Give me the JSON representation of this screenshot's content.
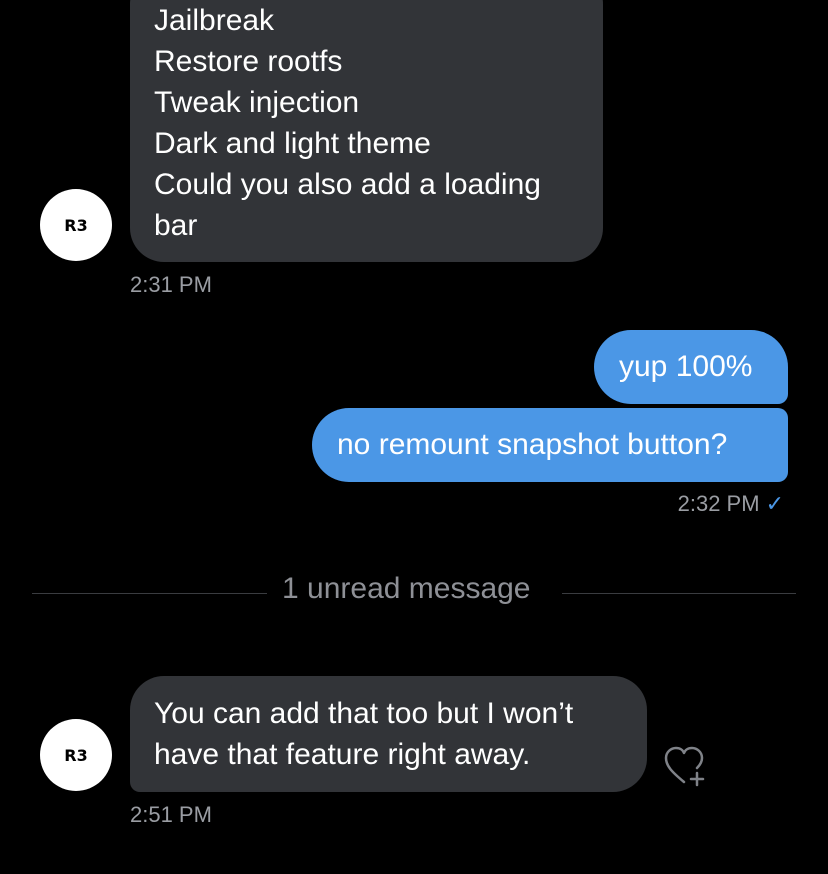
{
  "conversation": {
    "messages": [
      {
        "direction": "incoming",
        "avatar_initials": "R3",
        "lines": [
          "Jailbreak",
          "Restore rootfs",
          "Tweak injection",
          "Dark and light theme",
          "Could you also add a loading",
          "bar"
        ],
        "time": "2:31 PM"
      },
      {
        "direction": "outgoing",
        "text": "yup 100%"
      },
      {
        "direction": "outgoing",
        "text": "no remount snapshot button?",
        "time": "2:32 PM",
        "read_check": "✓"
      },
      {
        "direction": "incoming",
        "avatar_initials": "R3",
        "lines": [
          "You can add that too but I won’t",
          "have that feature right away."
        ],
        "time": "2:51 PM"
      }
    ],
    "unread_divider": "1 unread message",
    "react_icon": "heart-plus-icon"
  },
  "colors": {
    "background": "#000000",
    "incoming_bubble": "#323438",
    "outgoing_bubble": "#4b97e6",
    "timestamp": "#9a9da3",
    "check": "#4b97e6"
  }
}
